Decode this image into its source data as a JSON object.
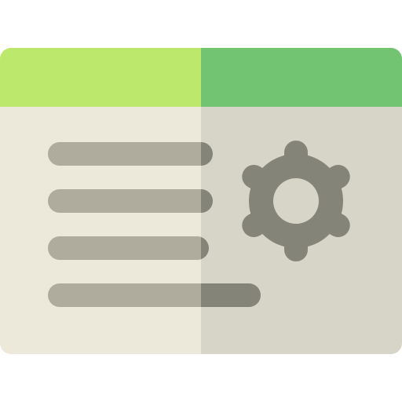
{
  "icon": {
    "name": "settings-window-icon",
    "parts": {
      "window": "browser-window",
      "content": "text-lines",
      "symbol": "gear-icon"
    }
  },
  "colors": {
    "title_bar_left": "#bce86c",
    "title_bar_right": "#72c472",
    "body_left": "#ece8da",
    "body_right": "#d7d5c8",
    "line_light": "#afac9d",
    "line_dark": "#858478",
    "gear": "#858478",
    "gear_hole": "#d7d5c8"
  },
  "text_lines": {
    "count": 4
  },
  "gear": {
    "spokes": 6
  }
}
